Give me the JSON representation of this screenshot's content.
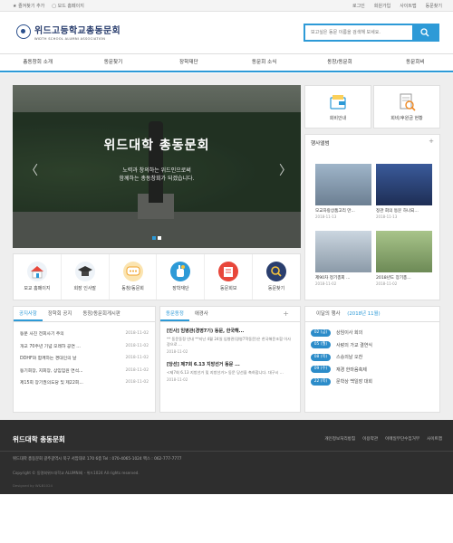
{
  "topbar": {
    "favorite": "즐겨찾기 추가",
    "mobile": "모드 홈페이지",
    "links": [
      "로그인",
      "회원가입",
      "사이트맵",
      "동문찾기"
    ]
  },
  "header": {
    "logo_ko": "위드고등학교총동문회",
    "logo_en": "WIDTH SCHOOL ALUMNI ASSOCIATION",
    "search_placeholder": "보고싶은 동문 이름을 검색해 보세요."
  },
  "nav": [
    "총동창회 소개",
    "동문찾기",
    "장학재단",
    "동문회 소식",
    "동창/동문회",
    "동문회비"
  ],
  "hero": {
    "title": "위드대학 총동문회",
    "sub1": "노력과 창의하는 위드인으로써",
    "sub2": "함께하는 총동창회가 되겠습니다."
  },
  "icon_boxes": [
    "회비안내",
    "회비/후원금 현황"
  ],
  "gallery": {
    "title": "행사앨범",
    "items": [
      {
        "caption": "모교자랑상품고리 만...",
        "date": "2018-11-13"
      },
      {
        "caption": "정관 회의 동문 하나되...",
        "date": "2018-11-13"
      },
      {
        "caption": "제90차 정기총회 ...",
        "date": "2018-11-02"
      },
      {
        "caption": "2018년도 장기총...",
        "date": "2018-11-02"
      }
    ]
  },
  "quick": [
    "모교 홈페이지",
    "회장 인사말",
    "동창/동문회",
    "장학재단",
    "동문회보",
    "동문찾기"
  ],
  "notice": {
    "tabs": [
      "공지사항",
      "장학회 공지",
      "동창/동문회게시판"
    ],
    "rows": [
      {
        "title": "동문 사진 전회사기 주의",
        "date": "2018-11-02"
      },
      {
        "title": "개교 70주년 기념 모레하 공연 ...",
        "date": "2018-11-02"
      },
      {
        "title": "DDHF와 함께하는 경대인의 날",
        "date": "2018-11-02"
      },
      {
        "title": "동기회장, 지회장, 상임임원 연석...",
        "date": "2018-11-02"
      },
      {
        "title": "제15회 장기권의도당 및 제22회...",
        "date": "2018-11-02"
      }
    ]
  },
  "news": {
    "tabs": [
      "동문동정",
      "애경사"
    ],
    "items": [
      {
        "title": "[인사] 임병관(경영7기) 동문, 한국해...",
        "body": "** 동문동정 안내 **지난 4월 24일 임병관(경영7학동문)은 한국해운조합 이사장으로 ...",
        "date": "2018-11-02"
      },
      {
        "title": "[당선] 제7회 6.13 지방선거 동문 ...",
        "body": "<제7회 6.13 지방선거 및 지방선거> 동문 당선을 축하합니다. 대구시 ...",
        "date": "2018-11-02"
      }
    ]
  },
  "events": {
    "title": "이달의 행사",
    "month": "(2018년 11월)",
    "items": [
      {
        "date": "02 (금)",
        "title": "상임이사 회의"
      },
      {
        "date": "05 (월)",
        "title": "사랑의 가교 결연식"
      },
      {
        "date": "08 (목)",
        "title": "스승의날 오찬"
      },
      {
        "date": "09 (수)",
        "title": "재경 한마음축제"
      },
      {
        "date": "22 (목)",
        "title": "문학상 백일장 대회"
      }
    ]
  },
  "footer": {
    "logo": "위드대학 총동문회",
    "links": [
      "개인정보처리방침",
      "이용약관",
      "이메일무단수집거부",
      "사이트맵"
    ],
    "address": "위드대학 총동문회   광주광역시 북구 서암대로 170 6층   Tel : 070-4065-1024   팩스 : 062-777-7777",
    "copyright": "Copyright © 동명회위드대학교 ALUMNI회 - 위드1024 All rights reserved.",
    "design": "Designed by W&B1024"
  },
  "colors": {
    "accent": "#2d9ad7",
    "footer_bg": "#2e2e2e",
    "badge": "#2c8cc9"
  }
}
